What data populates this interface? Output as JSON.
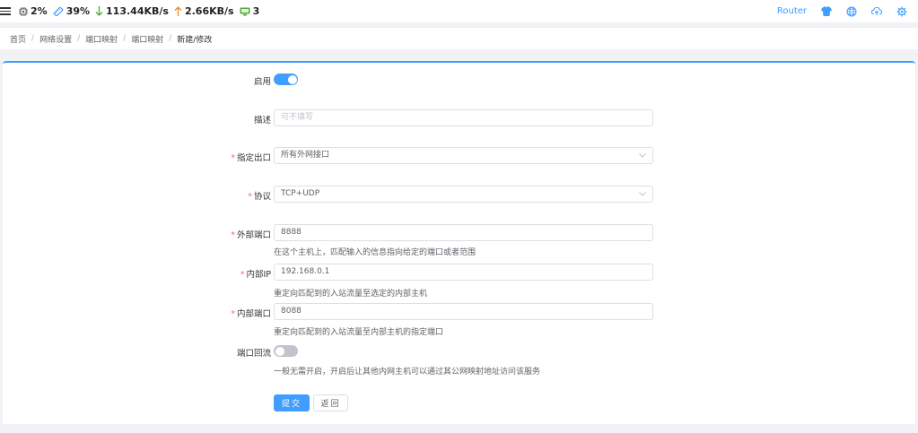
{
  "topbar": {
    "stats": [
      {
        "icon": "cpu-icon",
        "value": "2%"
      },
      {
        "icon": "memory-icon",
        "value": "39%"
      },
      {
        "icon": "download-arrow-icon",
        "value": "113.44KB/s",
        "color": "#52a83f"
      },
      {
        "icon": "upload-arrow-icon",
        "value": "2.66KB/s",
        "color": "#f08a24"
      },
      {
        "icon": "monitor-icon",
        "value": "3",
        "color": "#52a83f"
      }
    ],
    "router_label": "Router",
    "accent": "#409eff"
  },
  "breadcrumb": [
    "首页",
    "网络设置",
    "端口映射",
    "端口映射",
    "新建/修改"
  ],
  "form": {
    "enable": {
      "label": "启用",
      "on": true
    },
    "description": {
      "label": "描述",
      "placeholder": "可不填写",
      "value": ""
    },
    "outlet": {
      "label": "指定出口",
      "value": "所有外网接口",
      "required": true
    },
    "protocol": {
      "label": "协议",
      "value": "TCP+UDP",
      "required": true
    },
    "external_port": {
      "label": "外部端口",
      "value": "8888",
      "required": true,
      "hint": "在这个主机上，匹配输入的信息指向给定的端口或者范围"
    },
    "internal_ip": {
      "label": "内部IP",
      "value": "192.168.0.1",
      "required": true,
      "hint": "重定向匹配到的入站流量至选定的内部主机"
    },
    "internal_port": {
      "label": "内部端口",
      "value": "8088",
      "required": true,
      "hint": "重定向匹配到的入站流量至内部主机的指定端口"
    },
    "loopback": {
      "label": "端口回流",
      "on": false,
      "hint": "一般无需开启，开启后让其他内网主机可以通过其公网映射地址访问该服务"
    },
    "submit_label": "提交",
    "back_label": "返回"
  }
}
